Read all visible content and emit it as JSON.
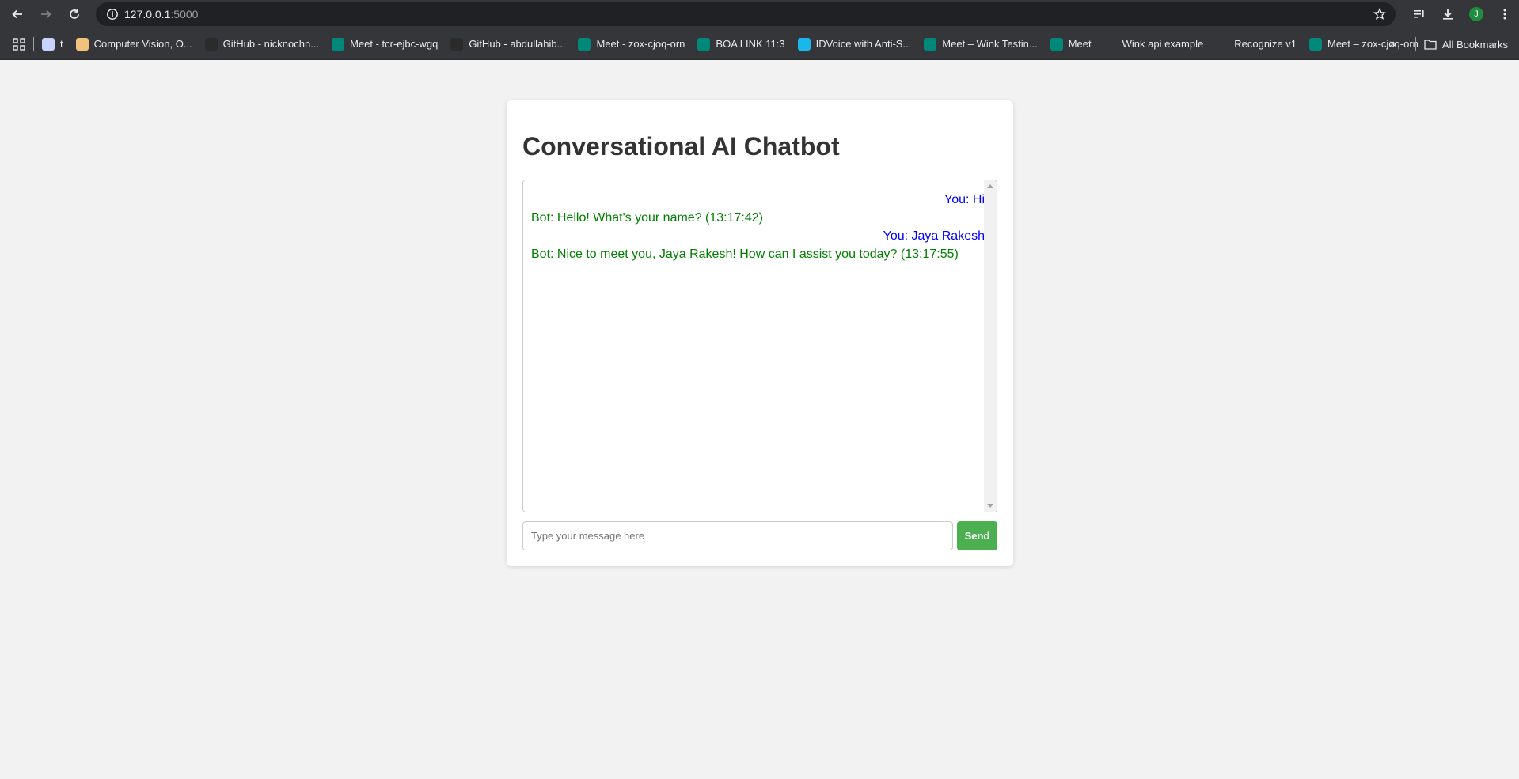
{
  "browser": {
    "url_host": "127.0.0.1",
    "url_port": ":5000",
    "bookmarks": [
      {
        "label": "t",
        "icon": "page-favicon-icon",
        "color": "#c7d2fe"
      },
      {
        "label": "Computer Vision, O...",
        "icon": "page-favicon-icon",
        "color": "#f0c27b"
      },
      {
        "label": "GitHub - nicknochn...",
        "icon": "github-icon",
        "color": "#2b2b2b"
      },
      {
        "label": "Meet - tcr-ejbc-wgq",
        "icon": "meet-icon",
        "color": "#00897b"
      },
      {
        "label": "GitHub - abdullahib...",
        "icon": "github-icon",
        "color": "#2b2b2b"
      },
      {
        "label": "Meet - zox-cjoq-orn",
        "icon": "meet-icon",
        "color": "#00897b"
      },
      {
        "label": "BOA LINK 11:3",
        "icon": "meet-icon",
        "color": "#00897b"
      },
      {
        "label": "IDVoice with Anti-S...",
        "icon": "vimeo-icon",
        "color": "#1ab7ea"
      },
      {
        "label": "Meet – Wink Testin...",
        "icon": "meet-icon",
        "color": "#00897b"
      },
      {
        "label": "Meet",
        "icon": "meet-icon",
        "color": "#00897b"
      },
      {
        "label": "Wink api example",
        "icon": "react-icon",
        "color": "#35363a"
      },
      {
        "label": "Recognize v1",
        "icon": "globe-icon",
        "color": "#35363a"
      },
      {
        "label": "Meet – zox-cjoq-orn",
        "icon": "meet-icon",
        "color": "#00897b"
      }
    ],
    "all_bookmarks_label": "All Bookmarks",
    "avatar_letter": "J"
  },
  "app": {
    "title": "Conversational AI Chatbot",
    "messages": [
      {
        "sender": "user",
        "text": "You: Hi"
      },
      {
        "sender": "bot",
        "text": "Bot: Hello! What's your name? (13:17:42)"
      },
      {
        "sender": "user",
        "text": "You: Jaya Rakesh"
      },
      {
        "sender": "bot",
        "text": "Bot: Nice to meet you, Jaya Rakesh! How can I assist you today? (13:17:55)"
      }
    ],
    "input_placeholder": "Type your message here",
    "send_label": "Send"
  },
  "colors": {
    "user_text": "#0000ff",
    "bot_text": "#008000",
    "send_button": "#4caf50",
    "chrome_bg": "#35363a"
  }
}
